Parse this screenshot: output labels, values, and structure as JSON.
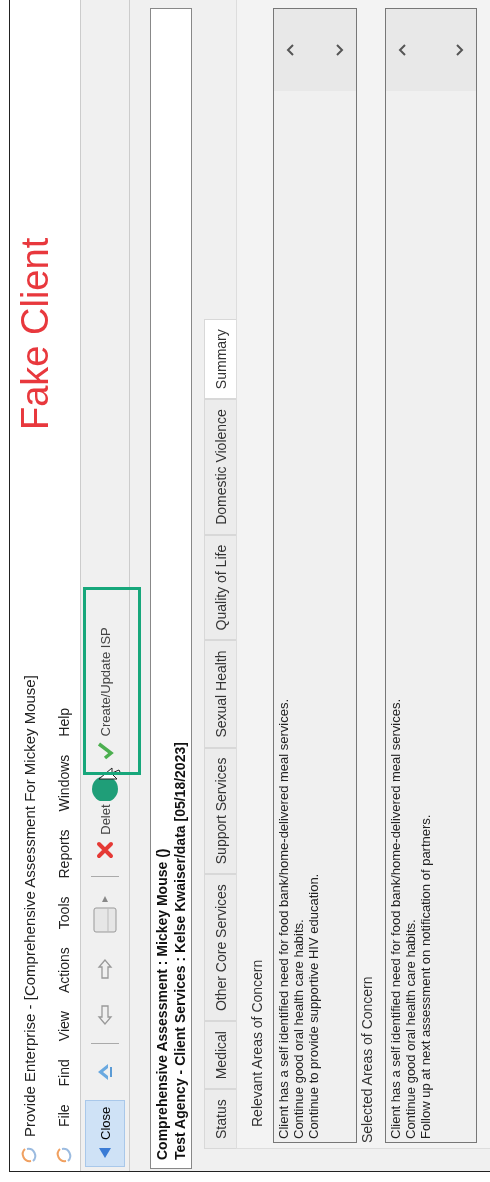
{
  "window": {
    "title": "Provide Enterprise - [Comprehensive Assessment For Mickey Mouse]"
  },
  "annotation": {
    "label": "Fake Client"
  },
  "menu": [
    "File",
    "Find",
    "View",
    "Actions",
    "Tools",
    "Reports",
    "Windows",
    "Help"
  ],
  "toolbar": [
    {
      "kind": "close",
      "label": "Close",
      "highlighted": true
    },
    {
      "kind": "spell",
      "highlighted": false
    },
    {
      "kind": "separator"
    },
    {
      "kind": "back",
      "highlighted": false
    },
    {
      "kind": "forward",
      "highlighted": false
    },
    {
      "kind": "page",
      "highlighted": false
    },
    {
      "kind": "separator"
    },
    {
      "kind": "delete",
      "label": "Delet",
      "highlighted": false
    },
    {
      "kind": "create",
      "label": "Create/Update ISP",
      "highlighted": false
    }
  ],
  "header": [
    "Comprehensive Assessment : Mickey Mouse ()",
    "Test Agency - Client Services : Kelse Kwaiser/data [05/18/2023]"
  ],
  "tabs": [
    {
      "label": "Status",
      "selected": false
    },
    {
      "label": "Medical",
      "selected": false
    },
    {
      "label": "Other Core Services",
      "selected": false
    },
    {
      "label": "Support Services",
      "selected": false
    },
    {
      "label": "Sexual Health",
      "selected": false
    },
    {
      "label": "Quality of Life",
      "selected": false
    },
    {
      "label": "Domestic Violence",
      "selected": false
    },
    {
      "label": "Summary",
      "selected": true
    }
  ],
  "sections": [
    {
      "label": "Relevant Areas of Concern",
      "lines": [
        "Client has a self identified need for food bank/home-delivered meal services.",
        "Continue good oral health care habits.",
        "Continue to provide supportive HIV education."
      ]
    },
    {
      "label": "Selected Areas of Concern",
      "lines": [
        "Client has a self identified need for food bank/home-delivered meal services.",
        "Continue good oral health care habits.",
        "Follow up at next assessment on notification of partners."
      ]
    }
  ]
}
